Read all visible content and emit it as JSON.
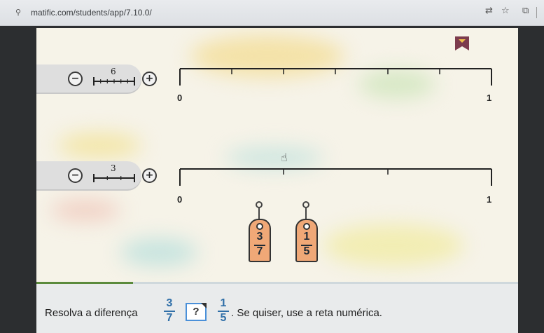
{
  "browser": {
    "url": "matific.com/students/app/7.10.0/",
    "site_icon": "⚲",
    "icons": {
      "translate": "⇄",
      "bookmark": "☆",
      "extensions": "⧉"
    }
  },
  "activity": {
    "number_lines": [
      {
        "ruler_value": "6",
        "start_label": "0",
        "end_label": "1",
        "divisions": 6
      },
      {
        "ruler_value": "3",
        "start_label": "0",
        "end_label": "1",
        "divisions": 3
      }
    ],
    "tags": [
      {
        "numerator": "3",
        "denominator": "7"
      },
      {
        "numerator": "1",
        "denominator": "5"
      }
    ],
    "progress_fraction": 0.2,
    "question": {
      "prefix": "Resolva a diferença",
      "frac1": {
        "numerator": "3",
        "denominator": "7"
      },
      "answer_placeholder": "?",
      "frac2": {
        "numerator": "1",
        "denominator": "5"
      },
      "suffix": ". Se quiser, use a reta numérica."
    }
  },
  "colors": {
    "accent_blue": "#2f6fa8",
    "tag_orange": "#f0a877",
    "progress_green": "#5b8a3c"
  }
}
